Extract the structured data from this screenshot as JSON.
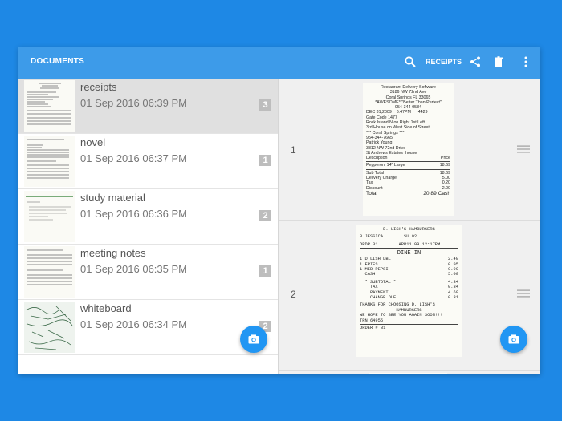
{
  "appbar": {
    "title": "DOCUMENTS",
    "action_label": "RECEIPTS",
    "icons": [
      "search-icon",
      "share-icon",
      "trash-icon",
      "more-vert-icon"
    ]
  },
  "documents": [
    {
      "name": "receipts",
      "date": "01 Sep 2016 06:39 PM",
      "count": "3",
      "selected": true
    },
    {
      "name": "novel",
      "date": "01 Sep 2016 06:37 PM",
      "count": "1",
      "selected": false
    },
    {
      "name": "study material",
      "date": "01 Sep 2016 06:36 PM",
      "count": "2",
      "selected": false
    },
    {
      "name": "meeting notes",
      "date": "01 Sep 2016 06:35 PM",
      "count": "1",
      "selected": false
    },
    {
      "name": "whiteboard",
      "date": "01 Sep 2016 06:34 PM",
      "count": "2",
      "selected": false
    }
  ],
  "pages": [
    {
      "number": "1",
      "receipt": {
        "header": [
          "Restaurant Delivery Software",
          "3186 NW 72nd Ave",
          "Coral Springs FL 33065",
          "*AWESOME* \"Better Than Perfect\"",
          "954-344-0584"
        ],
        "info": [
          "DEC 31,2009    6:47PM      4429",
          "Gate Code 1477",
          "Rock Island N on Right 1st Left",
          "3rd House on West Side of Street",
          "*** Coral Springs ***",
          "954-344-7665",
          "Patrick Young",
          "3812 NW 72nd Drive",
          "St Andrews Estates  house"
        ],
        "col_desc": "Description",
        "col_price": "Price",
        "items": [
          {
            "desc": "Pepperoni 14\" Large",
            "price": "18.69"
          }
        ],
        "totals": [
          {
            "label": "Sub Total",
            "value": "18.69"
          },
          {
            "label": "Delivery Charge",
            "value": "5.00"
          },
          {
            "label": "Tax",
            "value": "0.20"
          },
          {
            "label": "Discount",
            "value": "2.00"
          }
        ],
        "total_label": "Total",
        "total_value": "20.89 Cash"
      }
    },
    {
      "number": "2",
      "receipt": {
        "title": "D. LISH'S HAMBURGERS",
        "server": "3 JESSICA        SU 02",
        "order_line": "ORDR 31        APR11'99 12:17PM",
        "dine": "DINE IN",
        "items": [
          {
            "desc": "1 D LISH DBL",
            "price": "2.40"
          },
          {
            "desc": "1 FRIES",
            "price": "0.95"
          },
          {
            "desc": "1 MED PEPSI",
            "price": "0.99"
          },
          {
            "desc": "  CASH",
            "price": "5.00"
          }
        ],
        "totals": [
          {
            "label": "  * SUBTOTAL *",
            "value": "4.34"
          },
          {
            "label": "    TAX",
            "value": "0.34"
          },
          {
            "label": "    PAYMENT",
            "value": "4.69"
          },
          {
            "label": "    CHANGE DUE",
            "value": "0.31"
          }
        ],
        "thanks": [
          "THANKS FOR CHOOSING D. LISH'S",
          "HAMBURGERS",
          "WE HOPE TO SEE YOU AGAIN SOON!!!",
          "TRN 64955"
        ],
        "order_no": "ORDER # 31"
      }
    }
  ],
  "colors": {
    "background": "#1e88e5",
    "appbar": "#3d9be9",
    "fab": "#2196f3",
    "selected_row": "#e0e0e0"
  }
}
